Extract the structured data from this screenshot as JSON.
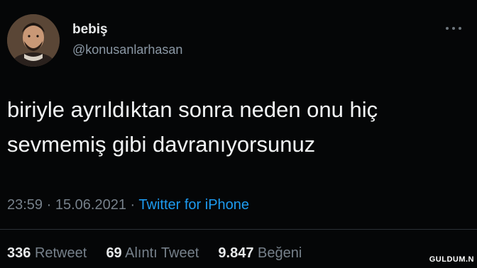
{
  "author": {
    "display_name": "bebiş",
    "handle": "@konusanlarhasan"
  },
  "tweet": {
    "lines": [
      "biriyle ayrıldıktan sonra neden onu hiç",
      "sevmemiş gibi davranıyorsunuz"
    ],
    "time": "23:59",
    "separator": "·",
    "date": "15.06.2021",
    "source": "Twitter for iPhone"
  },
  "stats": {
    "retweets_count": "336",
    "retweets_label": "Retweet",
    "quotes_count": "69",
    "quotes_label": "Alıntı Tweet",
    "likes_count": "9.847",
    "likes_label": "Beğeni"
  },
  "watermark": "GULDUM.N",
  "colors": {
    "background": "#050607",
    "text": "#e7e9ea",
    "muted": "#76808a",
    "link": "#1d9bf0"
  },
  "icons": [
    "more-icon"
  ]
}
